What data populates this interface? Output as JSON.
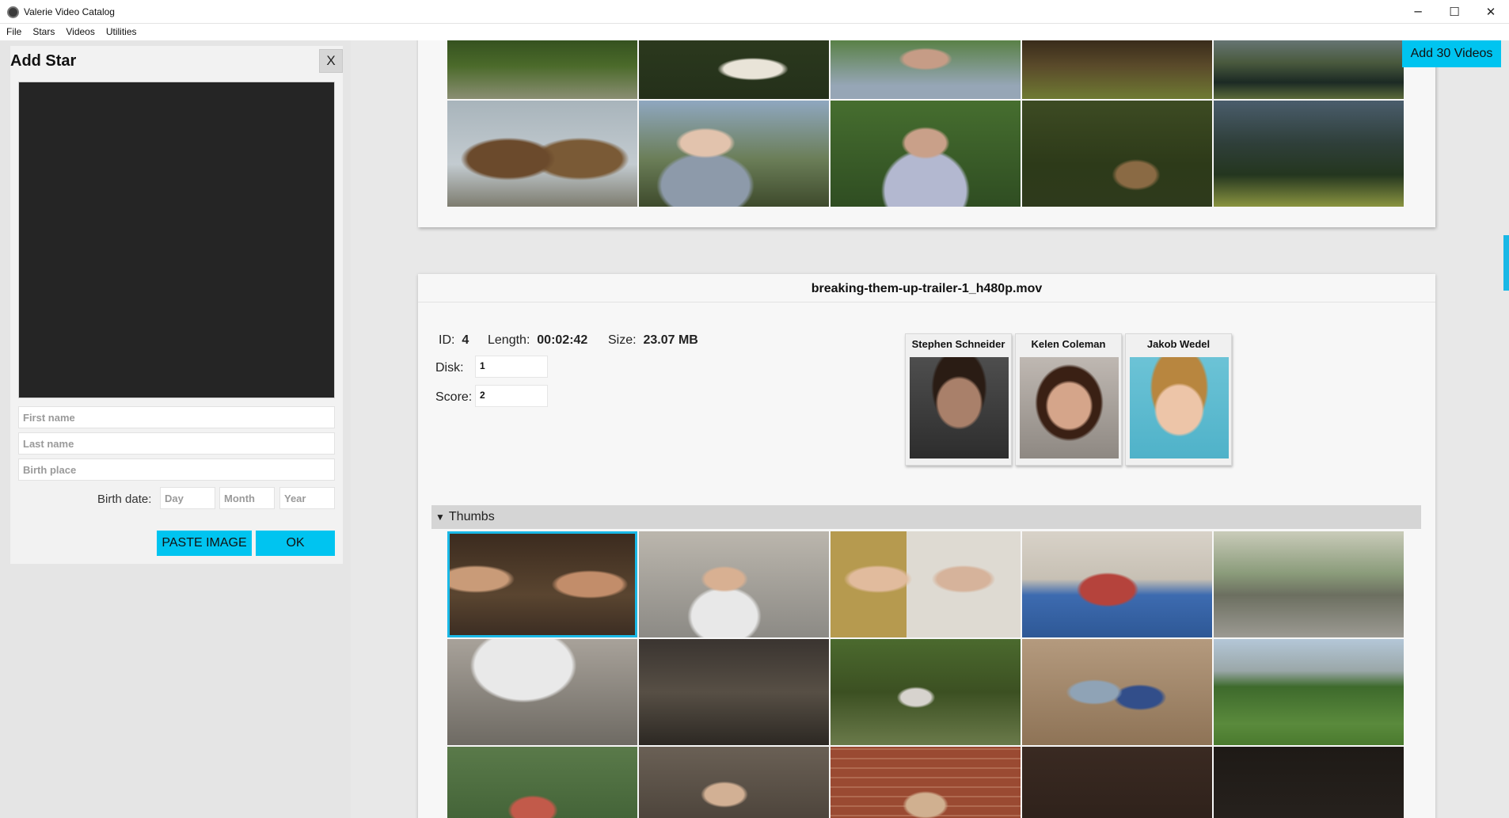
{
  "window": {
    "title": "Valerie Video Catalog",
    "minimize_glyph": "─",
    "maximize_glyph": "☐",
    "close_glyph": "✕"
  },
  "menu": [
    "File",
    "Stars",
    "Videos",
    "Utilities"
  ],
  "add_star": {
    "title": "Add Star",
    "close_label": "X",
    "first_name_placeholder": "First name",
    "last_name_placeholder": "Last name",
    "birth_place_placeholder": "Birth place",
    "birth_date_label": "Birth date:",
    "day_placeholder": "Day",
    "month_placeholder": "Month",
    "year_placeholder": "Year",
    "paste_image_label": "PASTE IMAGE",
    "ok_label": "OK"
  },
  "toolbar": {
    "add_videos_label": "Add 30 Videos"
  },
  "video": {
    "filename": "breaking-them-up-trailer-1_h480p.mov",
    "id_label": "ID:",
    "id_value": "4",
    "length_label": "Length:",
    "length_value": "00:02:42",
    "size_label": "Size:",
    "size_value": "23.07 MB",
    "disk_label": "Disk:",
    "disk_value": "1",
    "score_label": "Score:",
    "score_value": "2",
    "stars": [
      {
        "name": "Stephen Schneider"
      },
      {
        "name": "Kelen Coleman"
      },
      {
        "name": "Jakob Wedel"
      }
    ],
    "thumbs_section_label": "Thumbs"
  },
  "colors": {
    "accent": "#00c4f0",
    "selected_outline": "#1ab8e6"
  }
}
